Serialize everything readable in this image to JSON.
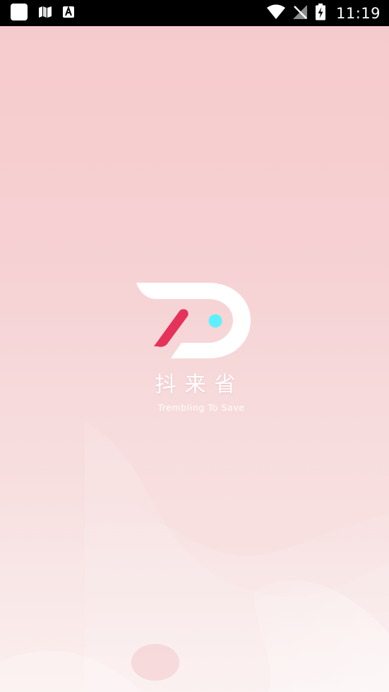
{
  "status_bar": {
    "time": "11:19",
    "left_icons": [
      "app-square-icon",
      "map-icon",
      "font-a-icon"
    ],
    "right_icons": [
      "wifi-icon",
      "no-signal-icon",
      "battery-charging-icon"
    ]
  },
  "splash": {
    "brand_name": "抖来省",
    "tagline": "Trembling To Save"
  },
  "colors": {
    "background_top": "#f6cbcd",
    "background_bottom": "#f9e6e6",
    "logo_white": "#ffffff",
    "logo_accent_red": "#e5325a",
    "logo_accent_cyan": "#5ff0ff"
  }
}
